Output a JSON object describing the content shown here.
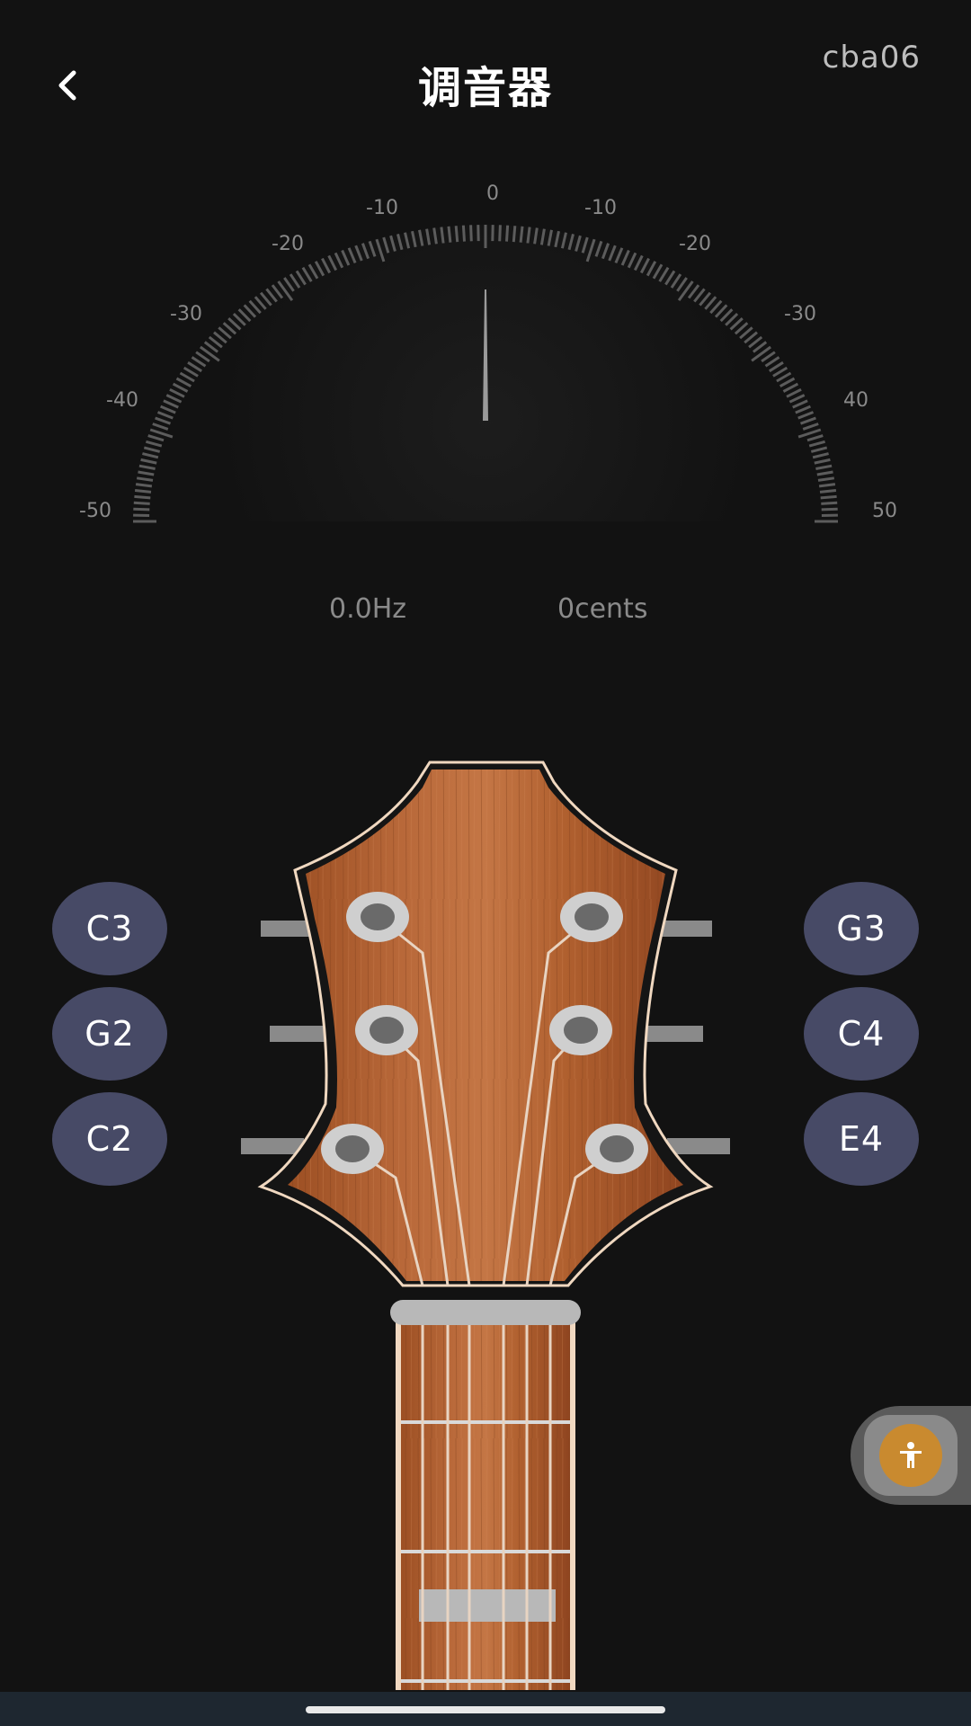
{
  "header": {
    "title": "调音器",
    "device_name": "cba06"
  },
  "meter": {
    "scale_labels": [
      "-50",
      "-40",
      "-30",
      "-20",
      "-10",
      "0",
      "-10",
      "-20",
      "-30",
      "40",
      "50"
    ],
    "needle_cents": 0,
    "frequency": "0.0Hz",
    "cents": "0cents"
  },
  "strings": {
    "left": [
      "C3",
      "G2",
      "C2"
    ],
    "right": [
      "G3",
      "C4",
      "E4"
    ]
  },
  "colors": {
    "background": "#121212",
    "note_button": "#474a66",
    "wood": "#b0612f",
    "accessibility_button": "#c98a2f"
  },
  "icons": {
    "back": "chevron-left-icon",
    "accessibility": "accessibility-icon"
  }
}
